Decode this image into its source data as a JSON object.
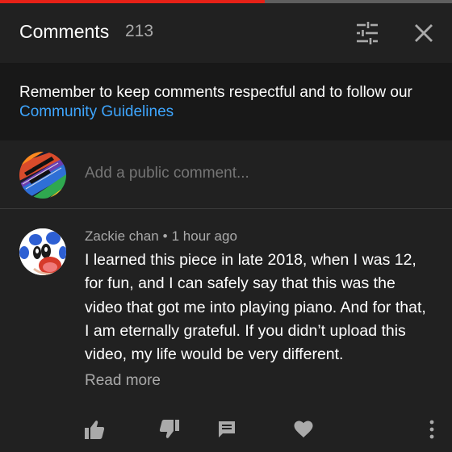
{
  "player": {
    "progress_fraction": 0.585
  },
  "header": {
    "title": "Comments",
    "count": "213",
    "filter_icon": "tune-sliders-icon",
    "close_icon": "close-icon"
  },
  "guidelines": {
    "text": "Remember to keep comments respectful and to follow our ",
    "link_label": "Community Guidelines",
    "link_color": "#3ea6ff"
  },
  "add_comment": {
    "placeholder": "Add a public comment..."
  },
  "comment": {
    "author": "Zackie chan",
    "separator": "•",
    "time": "1 hour ago",
    "body": "I learned this piece in late 2018, when I was 12, for fun, and I can safely say that this was the video that got me into playing piano. And for that, I am eternally grateful. If you didn’t upload this video, my life would be very different.",
    "read_more_label": "Read more",
    "actions": [
      "thumb-up-icon",
      "thumb-down-icon",
      "reply-icon",
      "heart-icon",
      "more-vertical-icon"
    ]
  },
  "colors": {
    "background": "#212121",
    "banner_background": "#181818",
    "progress_red": "#e62117",
    "secondary_text": "#aaaaaa"
  }
}
